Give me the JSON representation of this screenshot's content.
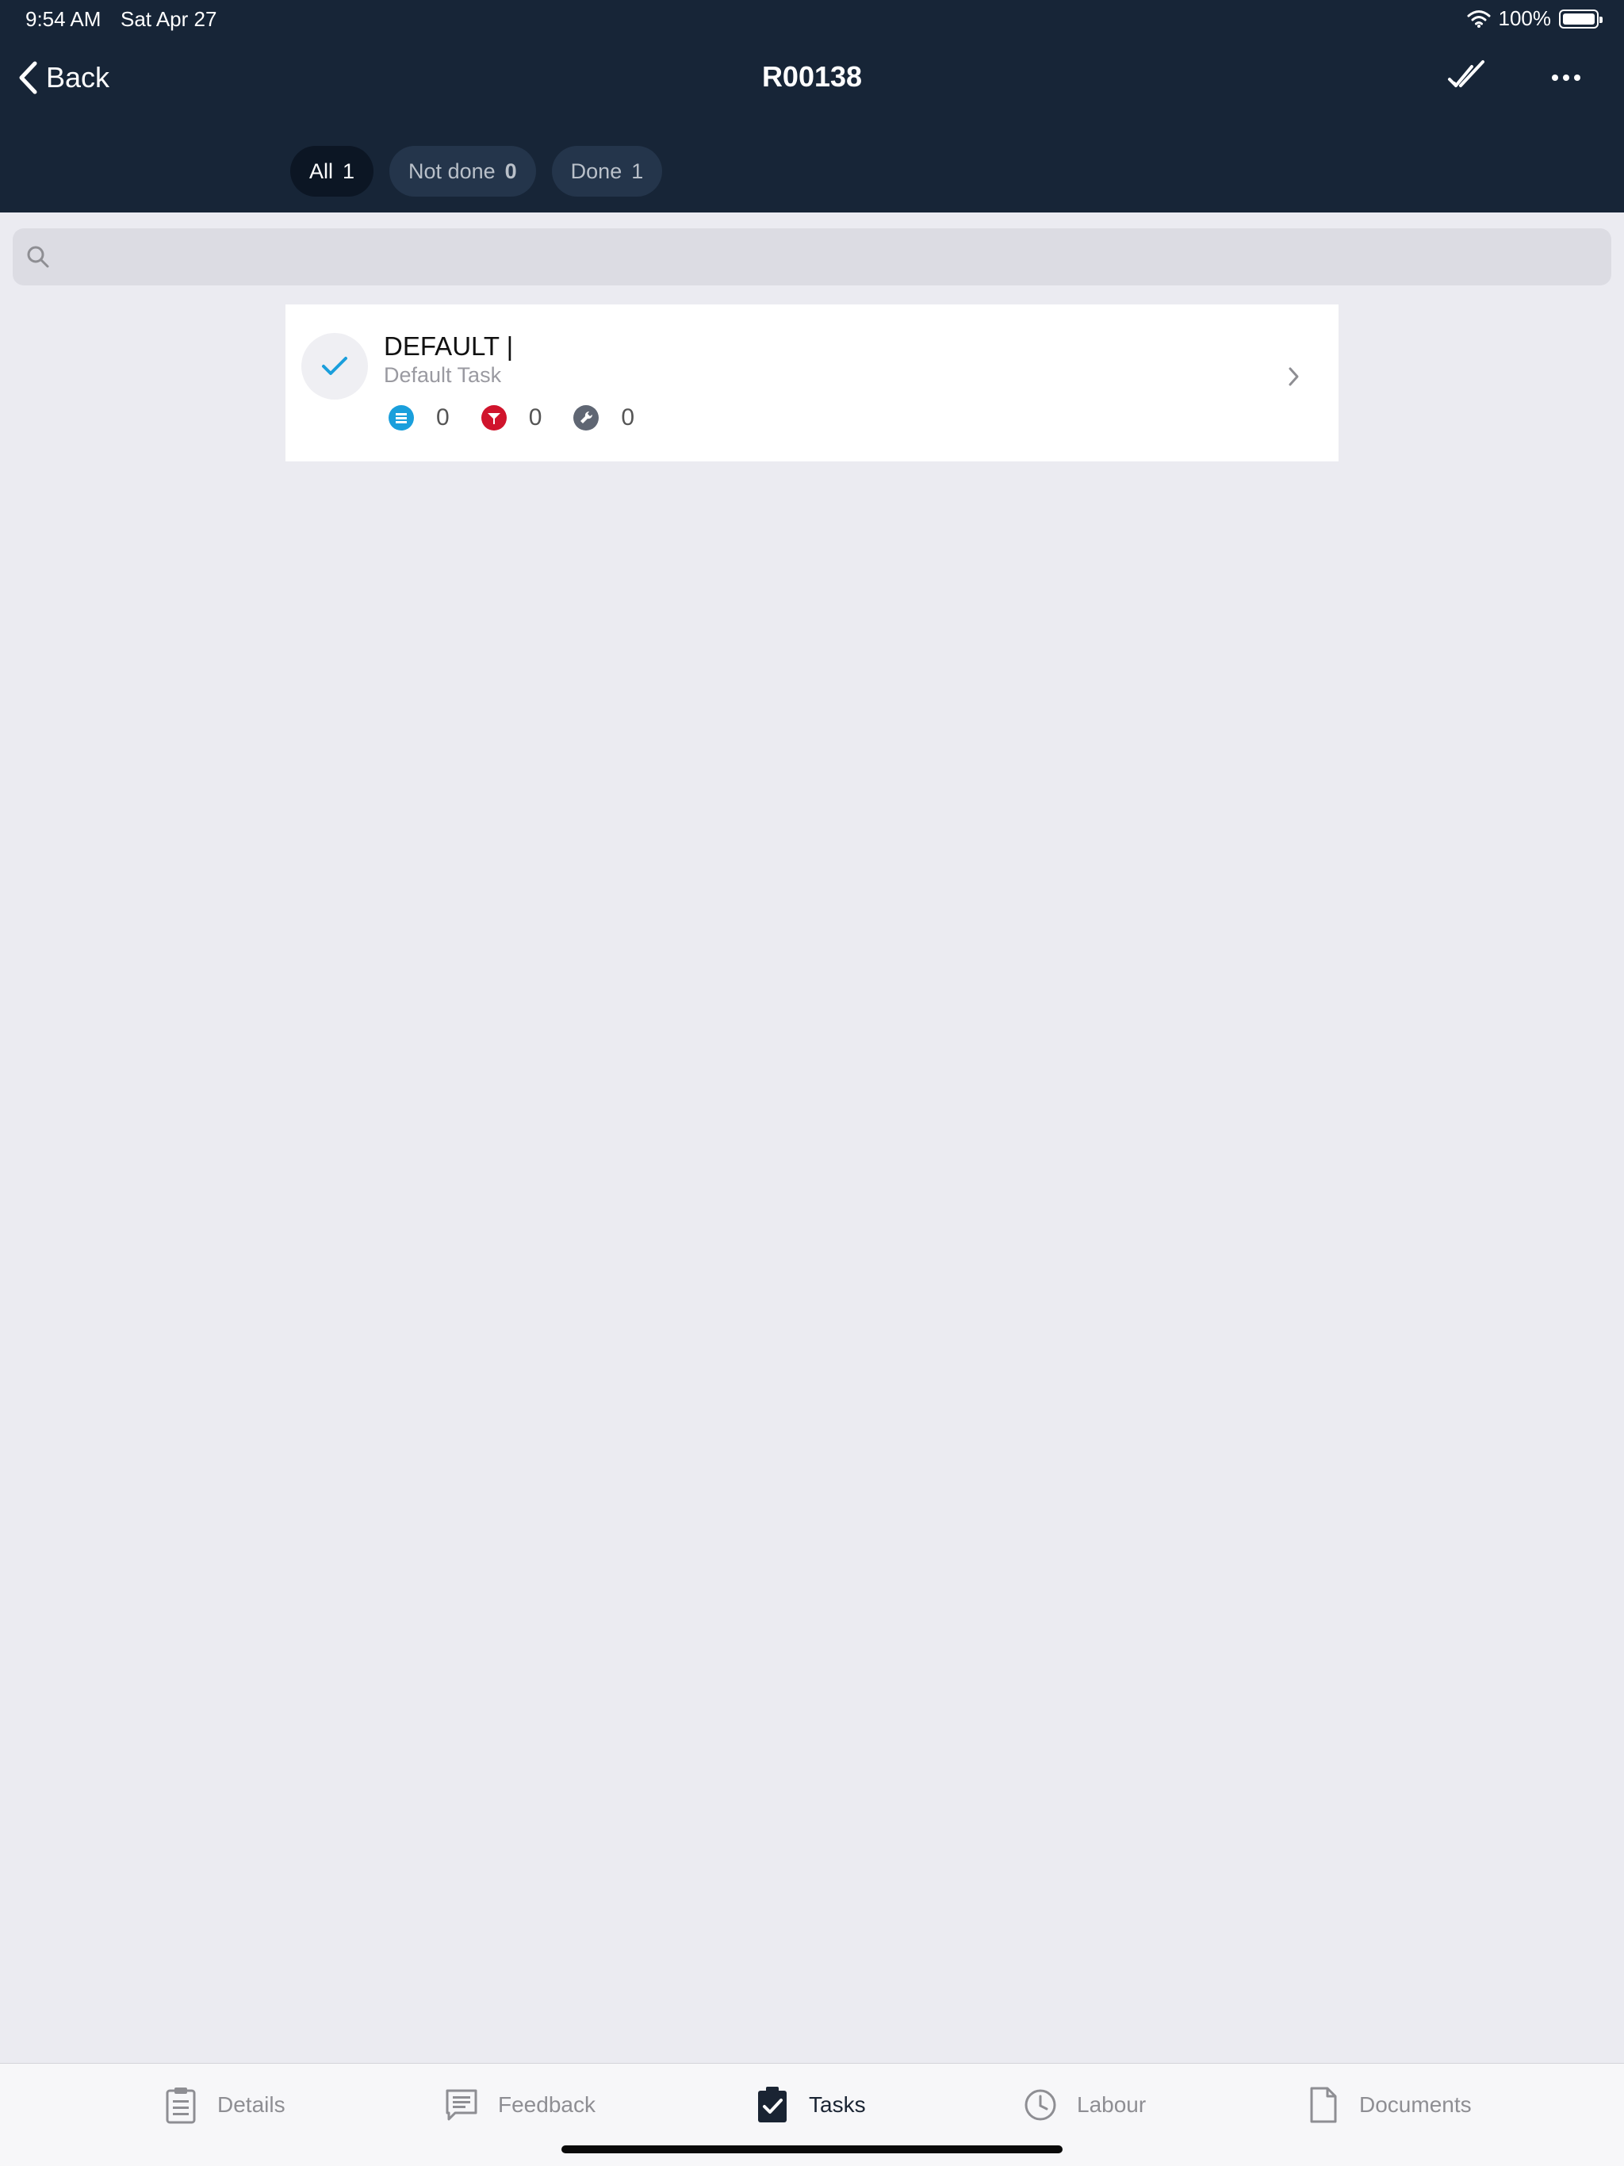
{
  "status_bar": {
    "time": "9:54 AM",
    "date": "Sat Apr 27",
    "battery": "100%",
    "icons": [
      "wifi-icon",
      "battery-icon"
    ]
  },
  "nav": {
    "back_label": "Back",
    "title": "R00138",
    "icons": [
      "chevron-left-icon",
      "double-check-icon",
      "more-icon"
    ]
  },
  "filters": [
    {
      "label": "All",
      "count": "1",
      "active": true
    },
    {
      "label": "Not done",
      "count": "0",
      "active": false
    },
    {
      "label": "Done",
      "count": "1",
      "active": false
    }
  ],
  "search": {
    "placeholder": "",
    "value": ""
  },
  "tasks": [
    {
      "title": "DEFAULT |",
      "subtitle": "Default Task",
      "done": true,
      "stats": [
        {
          "icon": "notes-icon",
          "color": "#1a9fdc",
          "value": "0"
        },
        {
          "icon": "defect-flag-icon",
          "color": "#d0142c",
          "value": "0"
        },
        {
          "icon": "wrench-icon",
          "color": "#5f6673",
          "value": "0"
        }
      ]
    }
  ],
  "tab_bar": [
    {
      "label": "Details",
      "icon": "clipboard-icon",
      "active": false
    },
    {
      "label": "Feedback",
      "icon": "message-icon",
      "active": false
    },
    {
      "label": "Tasks",
      "icon": "clipboard-check-icon",
      "active": true
    },
    {
      "label": "Labour",
      "icon": "clock-icon",
      "active": false
    },
    {
      "label": "Documents",
      "icon": "document-icon",
      "active": false
    }
  ],
  "colors": {
    "header_bg": "#172537",
    "page_bg": "#ebebf1",
    "accent_check": "#1a9fdc"
  }
}
